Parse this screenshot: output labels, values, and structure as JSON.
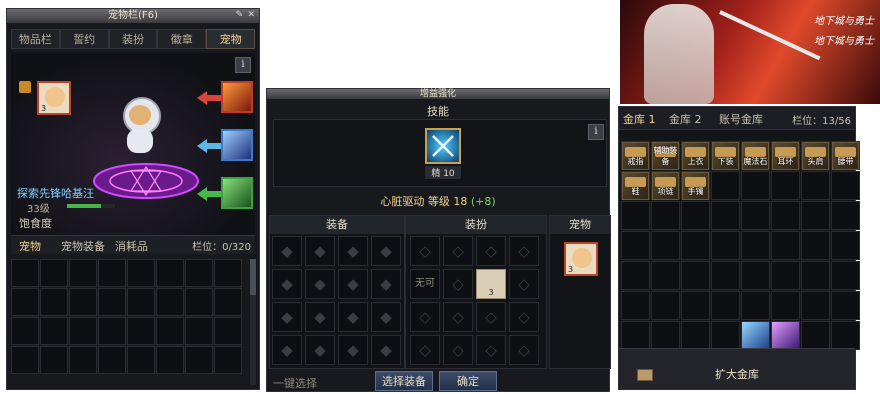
{
  "inventory": {
    "title": "宠物栏(F6)",
    "tabs": [
      "物品栏",
      "誓约",
      "装扮",
      "徽章",
      "宠物"
    ],
    "active_tab": 4,
    "info_label": "i",
    "pet_name": "探索先锋哈基汪",
    "pet_level": "33级",
    "hunger_label": "饱食度",
    "hunger_fraction": 0.7,
    "pet_badge": "3",
    "subtabs": [
      "宠物",
      "宠物装备",
      "消耗品"
    ],
    "slots_label": "栏位：0/320"
  },
  "enhance": {
    "title": "增益强化",
    "skill_label": "技能",
    "skill_badge": "精 10",
    "info_label": "i",
    "skill_line": "心脏驱动 等级 18",
    "skill_bonus": "(+8)",
    "col_equip": "装备",
    "col_costume": "装扮",
    "col_pet": "宠物",
    "costume_tag": "无可",
    "costume_badge": "3",
    "pet_badge": "3",
    "choose_button": "选择装备",
    "confirm_button": "确定",
    "footer_left": "一键选择"
  },
  "vault": {
    "tabs": [
      "金库 1",
      "金库 2",
      "账号金库"
    ],
    "slots_label": "栏位：13/56",
    "items_row1": [
      "戒指",
      "辅助装备",
      "上衣",
      "下装",
      "魔法石",
      "耳环",
      "头肩",
      "腰带"
    ],
    "items_row2": [
      "鞋",
      "项链",
      "手镯"
    ],
    "expand_button": "扩大金库"
  },
  "banner": {
    "caption1": "地下城与勇士",
    "caption2": "地下城与勇士"
  }
}
